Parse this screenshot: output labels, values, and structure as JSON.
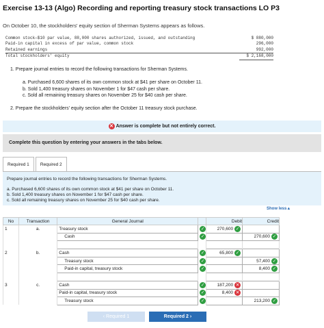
{
  "title": "Exercise 13-13 (Algo) Recording and reporting treasury stock transactions LO P3",
  "intro": "On October 10, the stockholders' equity section of Sherman Systems appears as follows.",
  "equity": [
    {
      "label": "Common stock—$10 par value, 88,000 shares authorized, issued, and outstanding",
      "amount": "$ 880,000"
    },
    {
      "label": "Paid-in capital in excess of par value, common stock",
      "amount": "296,000"
    },
    {
      "label": "Retained earnings",
      "amount": "992,000"
    },
    {
      "label": "Total stockholders' equity",
      "amount": "$ 2,168,000"
    }
  ],
  "q1": "1. Prepare journal entries to record the following transactions for Sherman Systems.",
  "items": [
    "a. Purchased 6,600 shares of its own common stock at $41 per share on October 11.",
    "b. Sold 1,400 treasury shares on November 1 for $47 cash per share.",
    "c. Sold all remaining treasury shares on November 25 for $40 cash per share."
  ],
  "q2": "2. Prepare the stockholders' equity section after the October 11 treasury stock purchase.",
  "banner": "Answer is complete but not entirely correct.",
  "complete_note": "Complete this question by entering your answers in the tabs below.",
  "tabs": [
    "Required 1",
    "Required 2"
  ],
  "panel_head": "Prepare journal entries to record the following transactions for Sherman Systems.",
  "panel_items": [
    "a. Purchased 6,600 shares of its own common stock at $41 per share on October 11.",
    "b. Sold 1,400 treasury shares on November 1 for $47 cash per share.",
    "c. Sold all remaining treasury shares on November 25 for $40 cash per share."
  ],
  "show_less": "Show less▲",
  "headers": {
    "no": "No",
    "transaction": "Transaction",
    "account": "General Journal",
    "debit": "Debit",
    "credit": "Credit"
  },
  "rows": [
    {
      "no": "1",
      "tr": "a.",
      "acc": "Treasury stock",
      "debit": "270,600",
      "credit": "",
      "dstat": "ok",
      "cstat": ""
    },
    {
      "no": "",
      "tr": "",
      "acc": "Cash",
      "debit": "",
      "credit": "270,600",
      "dstat": "",
      "cstat": "ok"
    },
    {
      "no": "2",
      "tr": "b.",
      "acc": "Cash",
      "debit": "65,800",
      "credit": "",
      "dstat": "ok",
      "cstat": ""
    },
    {
      "no": "",
      "tr": "",
      "acc": "Treasury stock",
      "debit": "",
      "credit": "57,400",
      "dstat": "",
      "cstat": "ok"
    },
    {
      "no": "",
      "tr": "",
      "acc": "Paid-in capital, treasury stock",
      "debit": "",
      "credit": "8,400",
      "dstat": "",
      "cstat": "ok"
    },
    {
      "no": "3",
      "tr": "c.",
      "acc": "Cash",
      "debit": "187,200",
      "credit": "",
      "dstat": "bad",
      "cstat": ""
    },
    {
      "no": "",
      "tr": "",
      "acc": "Paid-in capital, treasury stock",
      "debit": "8,400",
      "credit": "",
      "dstat": "bad",
      "cstat": ""
    },
    {
      "no": "",
      "tr": "",
      "acc": "Treasury stock",
      "debit": "",
      "credit": "213,200",
      "dstat": "",
      "cstat": "ok"
    }
  ],
  "btn_prev": "‹  Required 1",
  "btn_next": "Required 2  ›"
}
